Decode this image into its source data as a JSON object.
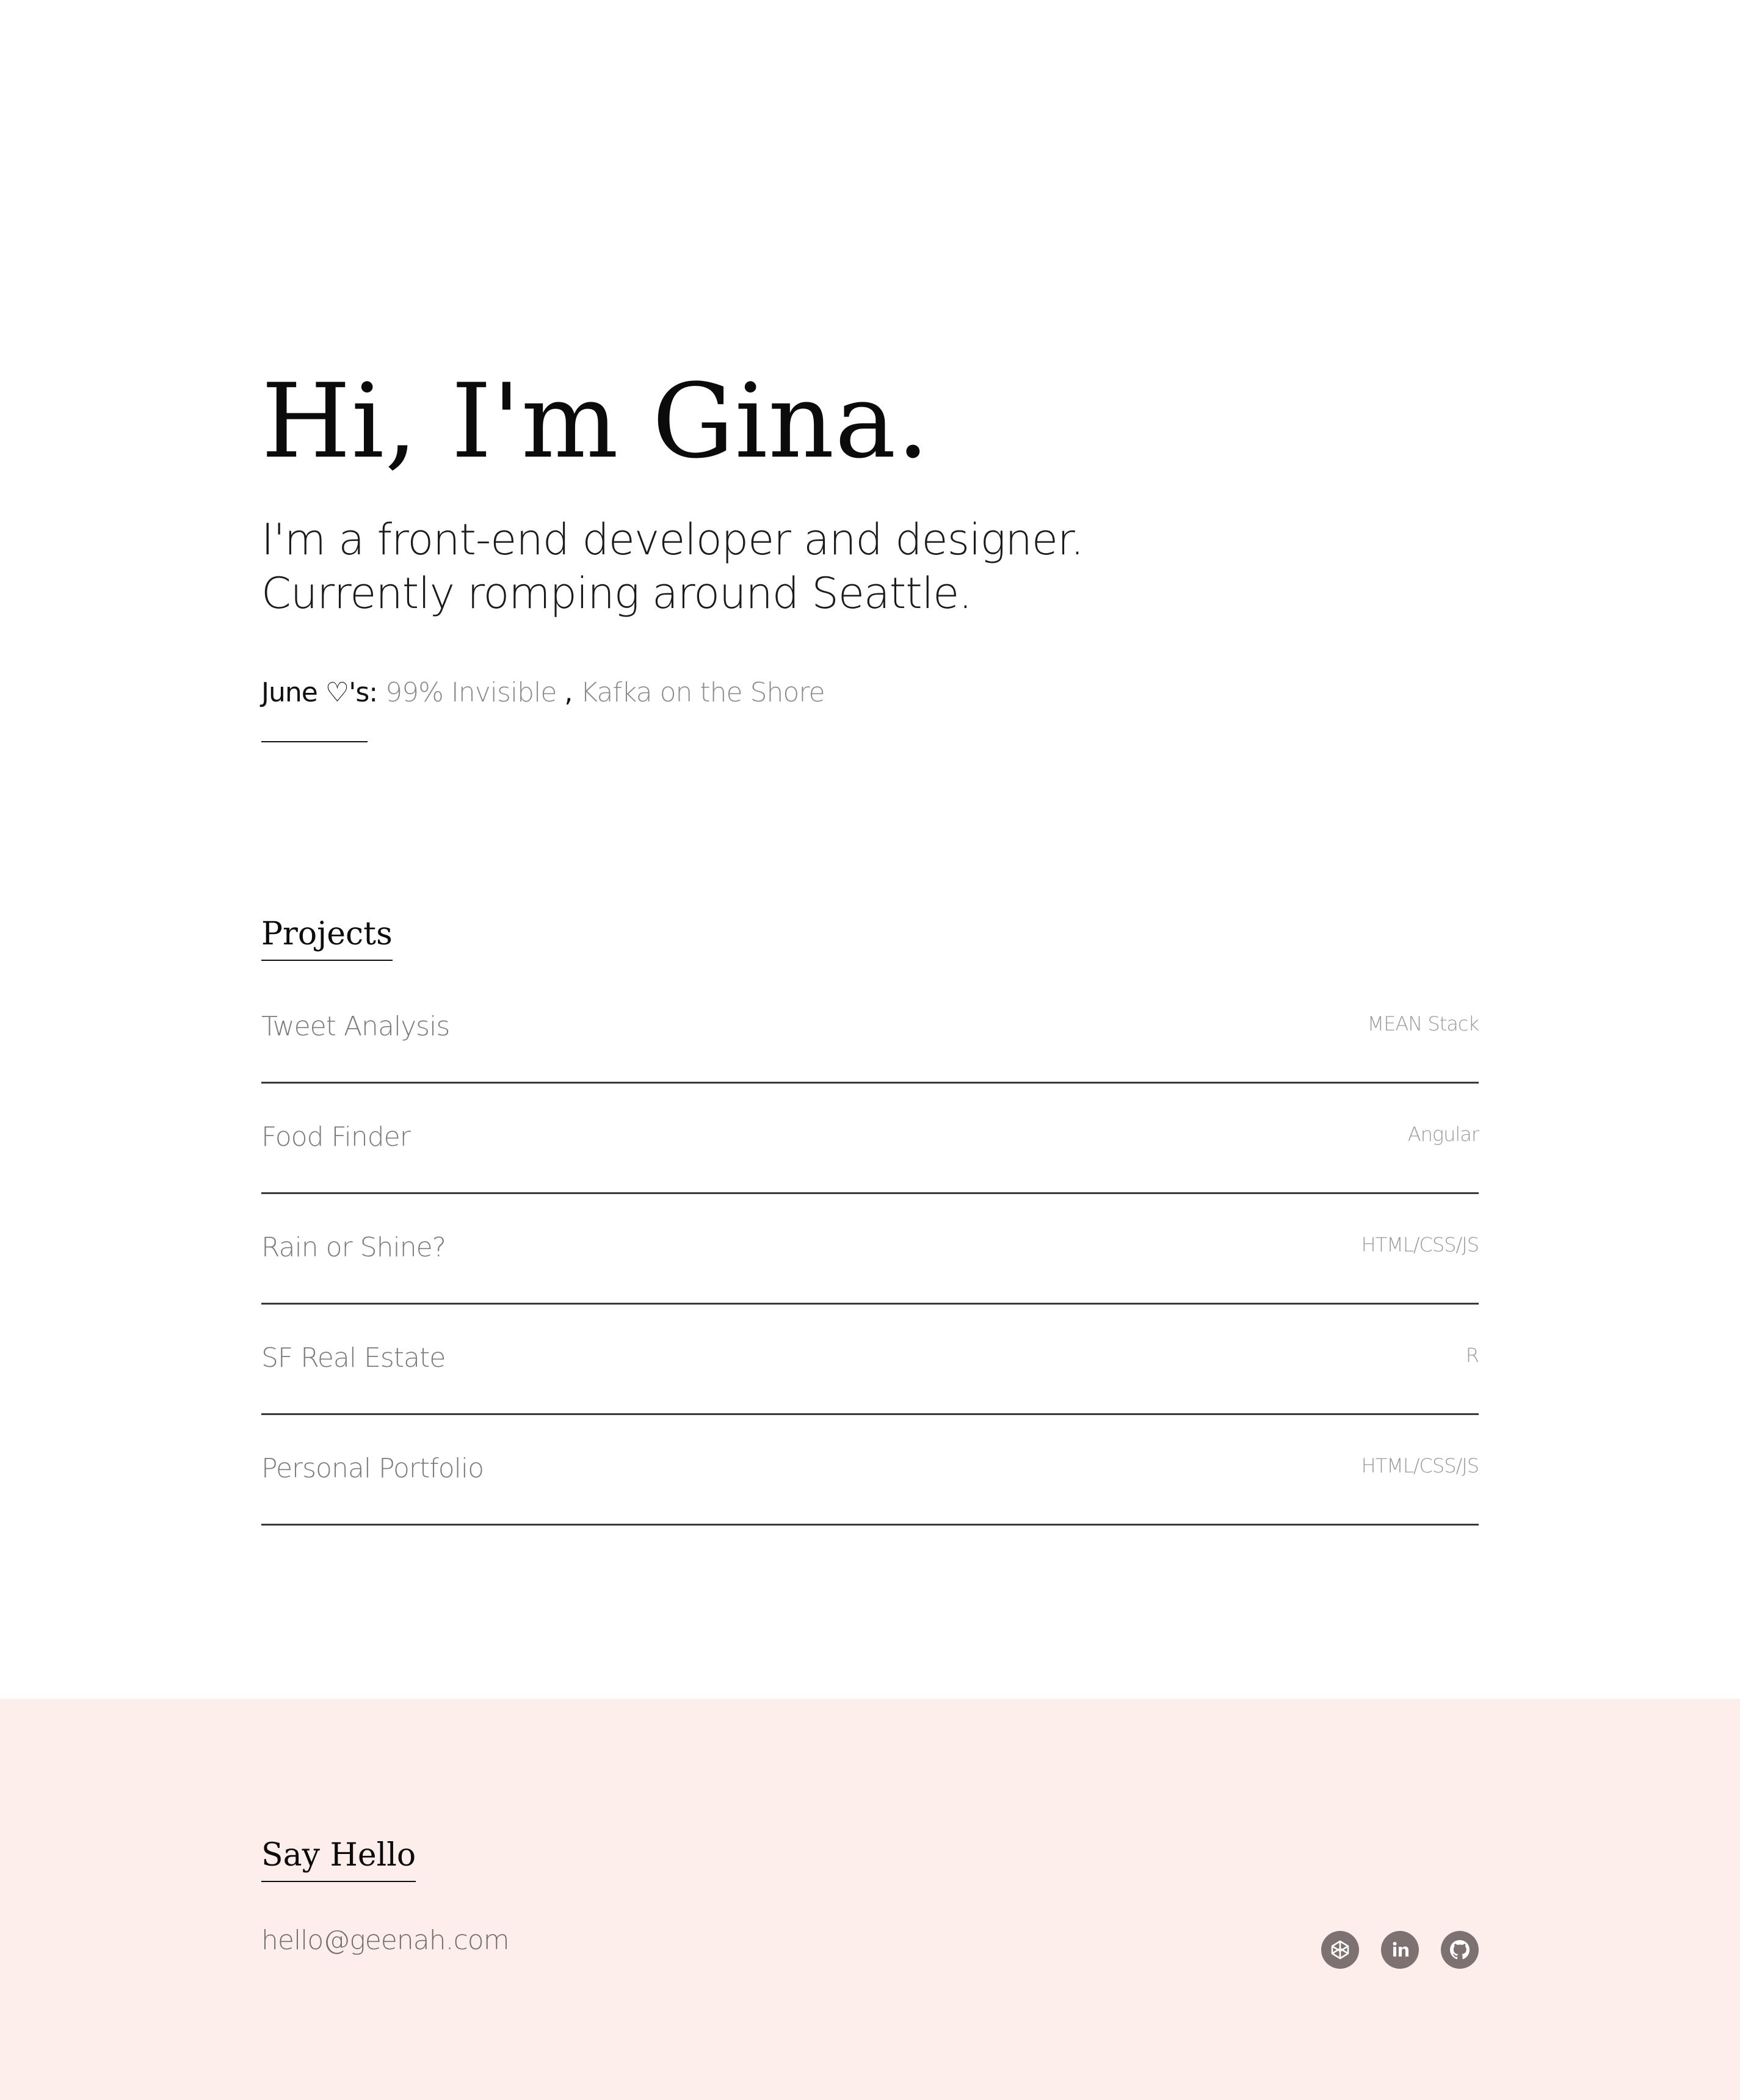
{
  "hero": {
    "title": "Hi, I'm Gina.",
    "intro_line1": "I'm a front-end developer and designer.",
    "intro_line2": "Currently romping around Seattle."
  },
  "favorites": {
    "label": "June ♡'s:",
    "items": [
      "99% Invisible",
      "Kafka on the Shore"
    ],
    "separator": ","
  },
  "projects": {
    "heading": "Projects",
    "items": [
      {
        "name": "Tweet Analysis",
        "tech": "MEAN Stack"
      },
      {
        "name": "Food Finder",
        "tech": "Angular"
      },
      {
        "name": "Rain or Shine?",
        "tech": "HTML/CSS/JS"
      },
      {
        "name": "SF Real Estate",
        "tech": "R"
      },
      {
        "name": "Personal Portfolio",
        "tech": "HTML/CSS/JS"
      }
    ]
  },
  "footer": {
    "heading": "Say Hello",
    "email": "hello@geenah.com",
    "social": [
      {
        "icon": "codepen-icon"
      },
      {
        "icon": "linkedin-icon"
      },
      {
        "icon": "github-icon"
      }
    ]
  },
  "colors": {
    "footer_bg": "#fdeeeb",
    "muted_text": "#7b7b7b",
    "icon_bg": "#7d7171"
  }
}
